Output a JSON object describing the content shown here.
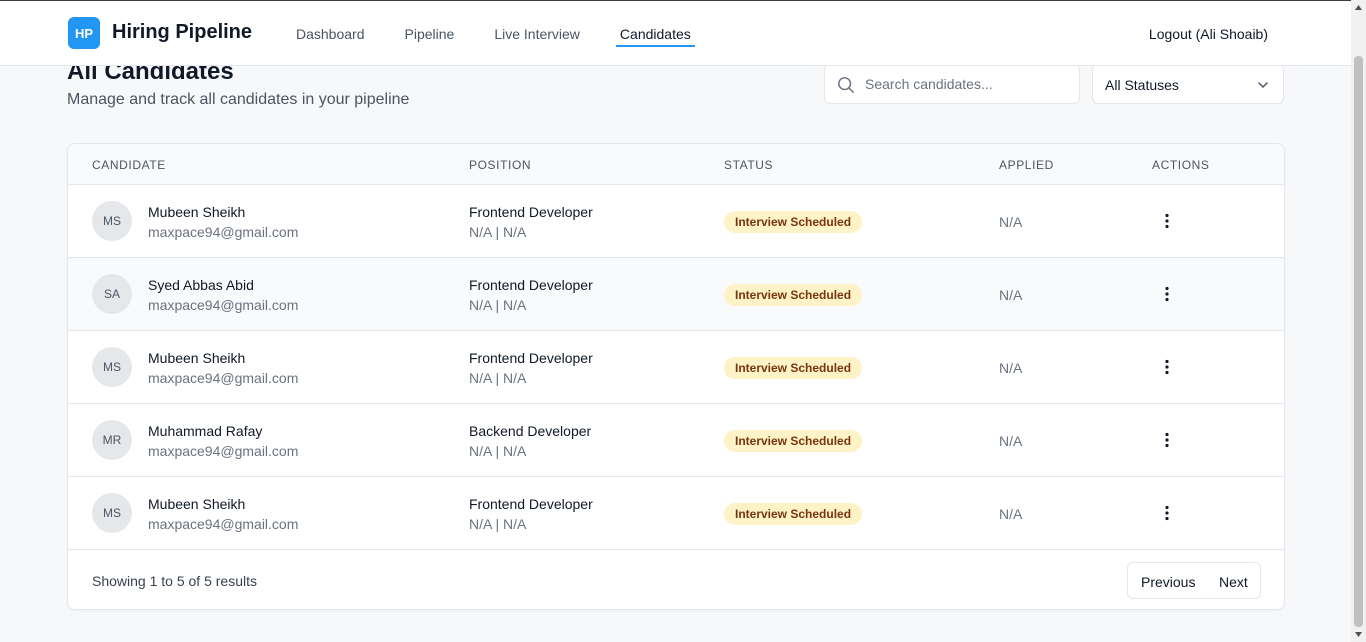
{
  "header": {
    "logo_text": "HP",
    "app_title": "Hiring Pipeline",
    "nav": [
      {
        "label": "Dashboard"
      },
      {
        "label": "Pipeline"
      },
      {
        "label": "Live Interview"
      },
      {
        "label": "Candidates",
        "active": true
      }
    ],
    "logout_label": "Logout (Ali Shoaib)",
    "accent_color": "#2196f3"
  },
  "page": {
    "title": "All Candidates",
    "subtitle": "Manage and track all candidates in your pipeline"
  },
  "search": {
    "placeholder": "Search candidates...",
    "value": "",
    "icon": "search-icon"
  },
  "status_filter": {
    "selected": "All Statuses"
  },
  "table": {
    "headers": [
      "CANDIDATE",
      "POSITION",
      "STATUS",
      "APPLIED",
      "ACTIONS"
    ],
    "rows": [
      {
        "initials": "MS",
        "name": "Mubeen Sheikh",
        "email": "maxpace94@gmail.com",
        "position": "Frontend Developer",
        "location": "N/A | N/A",
        "status": "Interview Scheduled",
        "applied": "N/A"
      },
      {
        "initials": "SA",
        "name": "Syed Abbas Abid",
        "email": "maxpace94@gmail.com",
        "position": "Frontend Developer",
        "location": "N/A | N/A",
        "status": "Interview Scheduled",
        "applied": "N/A"
      },
      {
        "initials": "MS",
        "name": "Mubeen Sheikh",
        "email": "maxpace94@gmail.com",
        "position": "Frontend Developer",
        "location": "N/A | N/A",
        "status": "Interview Scheduled",
        "applied": "N/A"
      },
      {
        "initials": "MR",
        "name": "Muhammad Rafay",
        "email": "maxpace94@gmail.com",
        "position": "Backend Developer",
        "location": "N/A | N/A",
        "status": "Interview Scheduled",
        "applied": "N/A"
      },
      {
        "initials": "MS",
        "name": "Mubeen Sheikh",
        "email": "maxpace94@gmail.com",
        "position": "Frontend Developer",
        "location": "N/A | N/A",
        "status": "Interview Scheduled",
        "applied": "N/A"
      }
    ],
    "status_badge_color": "#fef3c7"
  },
  "footer": {
    "summary": "Showing 1 to 5 of 5 results",
    "previous_label": "Previous",
    "next_label": "Next"
  }
}
